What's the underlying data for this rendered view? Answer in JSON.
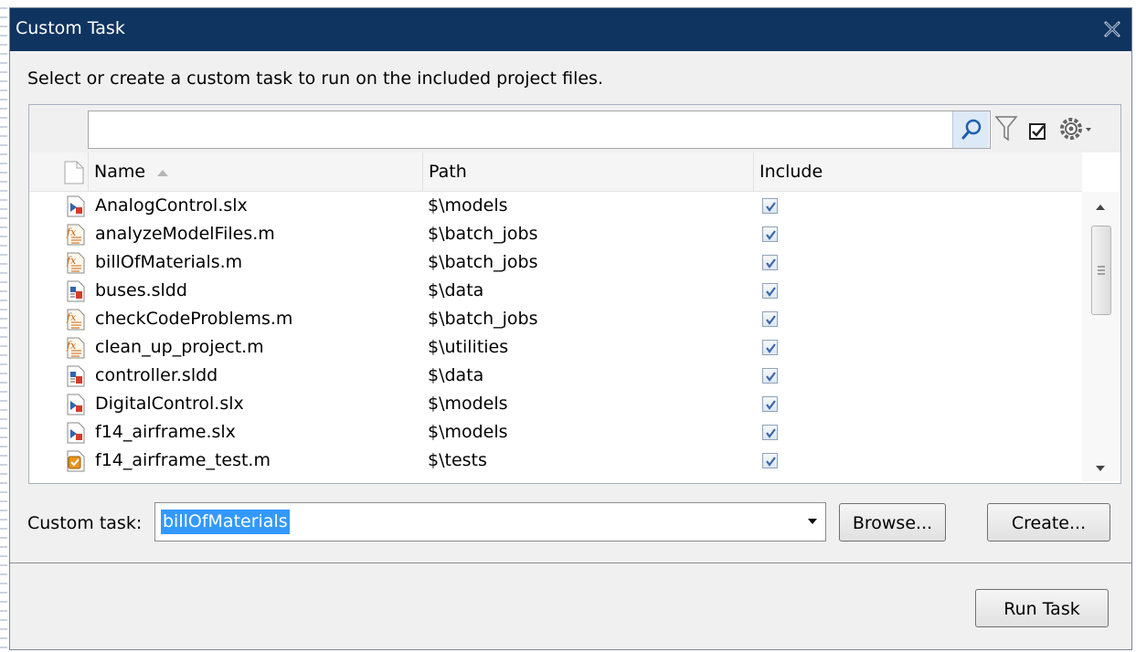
{
  "window": {
    "title": "Custom Task"
  },
  "instructions": "Select or create a custom task to run on the included project files.",
  "search": {
    "value": ""
  },
  "toolbar": {
    "icons": [
      "search-icon",
      "filter-icon",
      "checkbox-icon",
      "gear-icon"
    ]
  },
  "columns": {
    "name": "Name",
    "path": "Path",
    "include": "Include"
  },
  "files": [
    {
      "name": "AnalogControl.slx",
      "path": "$\\models",
      "type": "model",
      "included": true
    },
    {
      "name": "analyzeModelFiles.m",
      "path": "$\\batch_jobs",
      "type": "function",
      "included": true
    },
    {
      "name": "billOfMaterials.m",
      "path": "$\\batch_jobs",
      "type": "function",
      "included": true
    },
    {
      "name": "buses.sldd",
      "path": "$\\data",
      "type": "dictionary",
      "included": true
    },
    {
      "name": "checkCodeProblems.m",
      "path": "$\\batch_jobs",
      "type": "function",
      "included": true
    },
    {
      "name": "clean_up_project.m",
      "path": "$\\utilities",
      "type": "function",
      "included": true
    },
    {
      "name": "controller.sldd",
      "path": "$\\data",
      "type": "dictionary",
      "included": true
    },
    {
      "name": "DigitalControl.slx",
      "path": "$\\models",
      "type": "model",
      "included": true
    },
    {
      "name": "f14_airframe.slx",
      "path": "$\\models",
      "type": "model",
      "included": true
    },
    {
      "name": "f14_airframe_test.m",
      "path": "$\\tests",
      "type": "test",
      "included": true
    }
  ],
  "custom_task": {
    "label": "Custom task:",
    "value": "billOfMaterials"
  },
  "buttons": {
    "browse": "Browse...",
    "create": "Create...",
    "run": "Run Task"
  },
  "colors": {
    "titlebar": "#0f3460",
    "selection": "#3399ff"
  }
}
